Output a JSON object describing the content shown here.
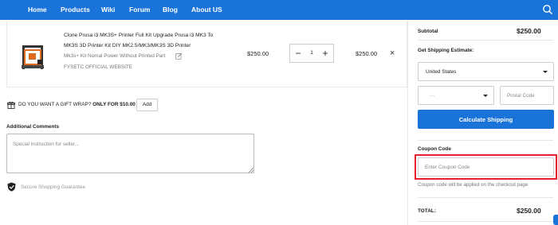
{
  "nav": {
    "items": [
      "Home",
      "Products",
      "Wiki",
      "Forum",
      "Blog",
      "About US"
    ],
    "search_icon": "search-icon"
  },
  "cart_item": {
    "title": "Clone Prusa i3 MK3S+ Printer Full Kit Upgrade Prusa i3 MK3 To MK3S 3D Printer Kit DIY MK2.5/MK3/MK3S 3D Printer",
    "variant": "Mk3s+ Kit Nomal Power Without Printed Part",
    "vendor": "FYSETC OFFICIAL WEBSITE",
    "price": "$250.00",
    "quantity": "1",
    "line_total": "$250.00",
    "remove_symbol": "×",
    "minus_symbol": "−",
    "plus_symbol": "+"
  },
  "gift_wrap": {
    "question": "DO YOU WANT A GIFT WRAP?",
    "offer": "ONLY FOR $10.00",
    "button": "Add"
  },
  "comments": {
    "label": "Additional Comments",
    "placeholder": "Special instruction for seller..."
  },
  "secure": {
    "text": "Secure Shopping Guarantee"
  },
  "summary": {
    "subtotal_label": "Subtotal",
    "subtotal_value": "$250.00",
    "shipping_label": "Get Shipping Estimate:",
    "country": "United States",
    "region": "---",
    "postal_placeholder": "Postal Code",
    "calc_button": "Calculate Shipping",
    "coupon_label": "Coupon Code",
    "coupon_placeholder": "Enter Coupon Code",
    "coupon_note": "Coupon code will be applied on the checkout page",
    "total_label": "TOTAL:",
    "total_value": "$250.00"
  },
  "colors": {
    "brand_blue": "#1a73d9",
    "highlight_red": "#e3202b"
  }
}
